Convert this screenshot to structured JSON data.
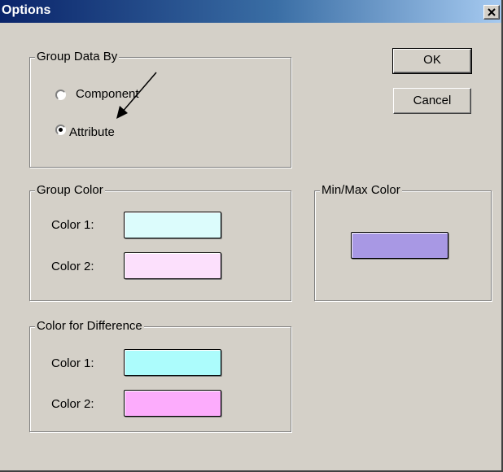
{
  "window": {
    "title": "Options",
    "close_glyph": "×"
  },
  "group_data_by": {
    "label": "Group Data By",
    "options": [
      {
        "label": "Component",
        "selected": false
      },
      {
        "label": "Attribute",
        "selected": true
      }
    ]
  },
  "buttons": {
    "ok_label": "OK",
    "cancel_label": "Cancel"
  },
  "group_color": {
    "label": "Group Color",
    "color1_label": "Color 1:",
    "color2_label": "Color 2:",
    "color1": "#dcfcfc",
    "color2": "#fce0fc"
  },
  "minmax_color": {
    "label": "Min/Max Color",
    "color": "#a898e4"
  },
  "color_for_difference": {
    "label": "Color for Difference",
    "color1_label": "Color 1:",
    "color2_label": "Color 2:",
    "color1": "#acfcfc",
    "color2": "#fcacfc"
  },
  "annotation": {
    "arrow": "arrow pointing to Attribute radio"
  }
}
